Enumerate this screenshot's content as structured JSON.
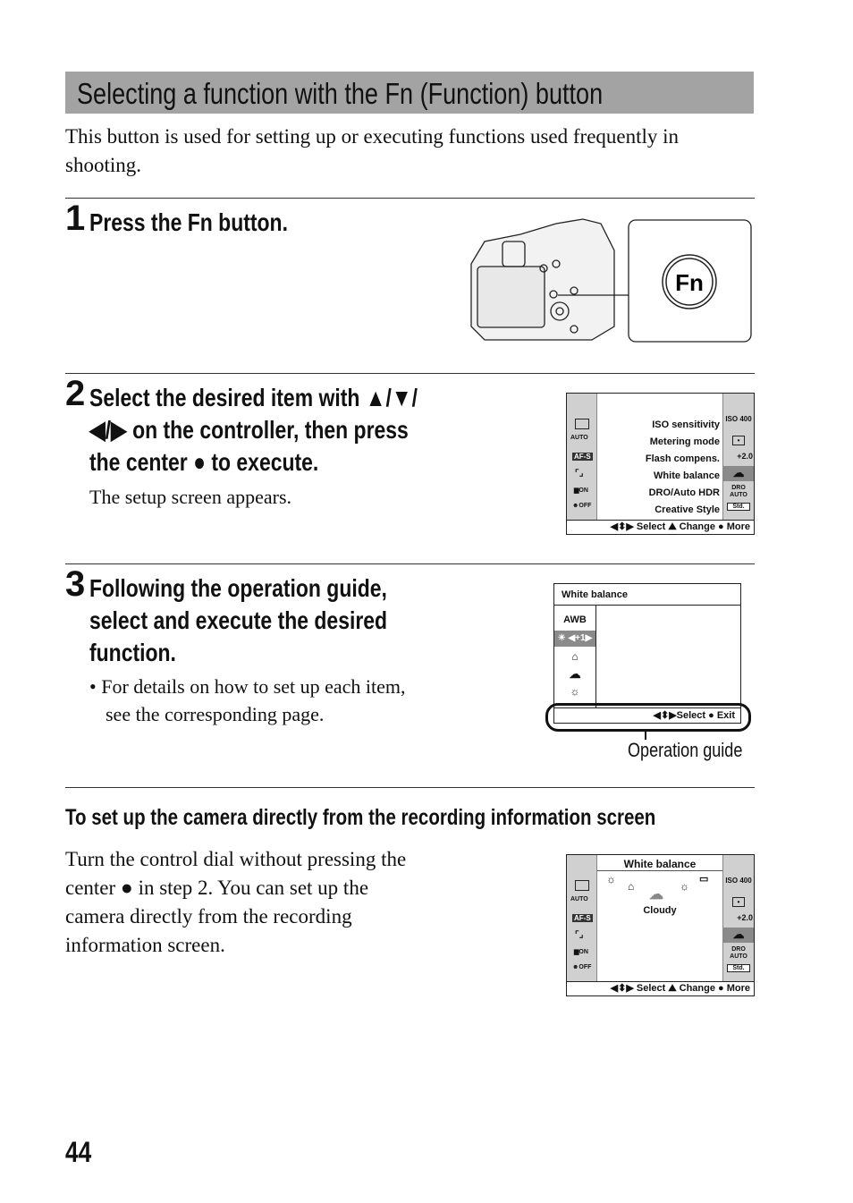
{
  "section_title": "Selecting a function with the Fn (Function) button",
  "intro": "This button is used for setting up or executing functions used frequently in shooting.",
  "steps": [
    {
      "number": "1",
      "heading": "Press the Fn button.",
      "fn_label": "Fn"
    },
    {
      "number": "2",
      "heading_lines": [
        "Select the desired item with ▲/▼/",
        "◀/▶ on the controller, then press",
        "the center ● to execute."
      ],
      "note": "The setup screen appears."
    },
    {
      "number": "3",
      "heading_lines": [
        "Following the operation guide,",
        "select and execute the desired",
        "function."
      ],
      "bullet": "For details on how to set up each item, see the corresponding page.",
      "bullet_lines": [
        "For details on how to set up each item,",
        "see the corresponding page."
      ]
    }
  ],
  "screen_setup": {
    "left_icons": [
      "AUTO",
      "AF-S",
      "ON",
      "OFF"
    ],
    "items": [
      "ISO sensitivity",
      "Metering mode",
      "Flash compens.",
      "White balance",
      "DRO/Auto HDR",
      "Creative Style"
    ],
    "right_values": [
      "ISO 400",
      "•",
      "+2.0",
      "cloud",
      "DRO AUTO",
      "Std."
    ],
    "guide": "◀⬍▶ Select  ⛰ Change  ● More"
  },
  "screen_wb": {
    "title": "White balance",
    "options": [
      "AWB",
      "☀ ◀+1▶",
      "shade",
      "cloudy",
      "tungsten"
    ],
    "guide": "◀⬍▶Select  ● Exit",
    "callout": "Operation guide"
  },
  "subsection": {
    "title": "To set up the camera directly from the recording information screen",
    "text_lines": [
      "Turn the control dial without pressing the",
      "center ● in step 2. You can set up the",
      "camera directly from the recording",
      "information screen."
    ]
  },
  "screen_direct": {
    "title": "White balance",
    "selected": "Cloudy",
    "guide": "◀⬍▶ Select  ⛰ Change  ● More"
  },
  "page_number": "44"
}
